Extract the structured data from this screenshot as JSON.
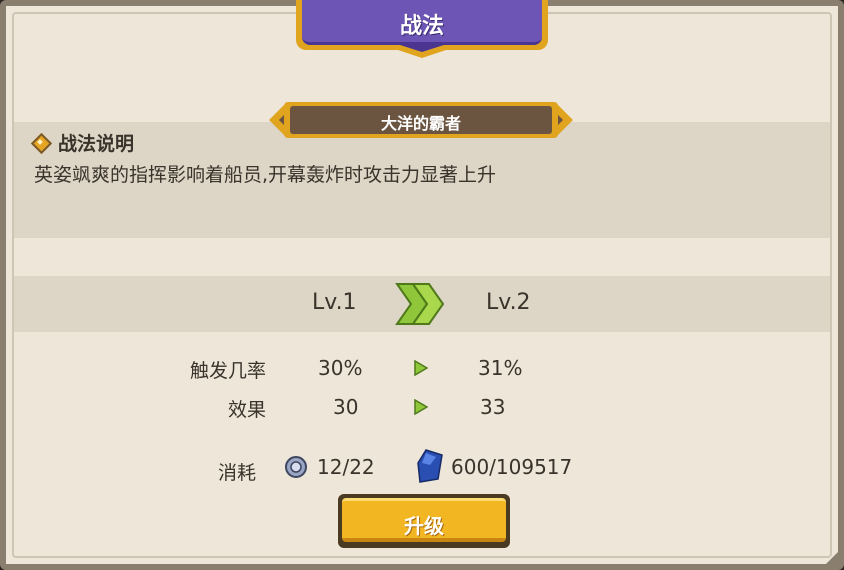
{
  "title": "战法",
  "skill_name": "大洋的霸者",
  "description": {
    "header": "战法说明",
    "text": "英姿飒爽的指挥影响着船员,开幕轰炸时攻击力显著上升"
  },
  "levels": {
    "current": "Lv.1",
    "next": "Lv.2"
  },
  "stats": [
    {
      "label": "触发几率",
      "current": "30%",
      "next": "31%"
    },
    {
      "label": "效果",
      "current": "30",
      "next": "33"
    }
  ],
  "cost": {
    "label": "消耗",
    "item_amount": "12/22",
    "gem_amount": "600/109517"
  },
  "upgrade_button": "升级",
  "colors": {
    "panel_bg": "#ede6d9",
    "title_purple": "#6d55b6",
    "gold": "#e0a41f",
    "button_yellow": "#f3b623",
    "arrow_green": "#8fc63a"
  },
  "icons": {
    "description": "diamond-icon",
    "level_arrow": "double-chevron-right-icon",
    "stat_arrow": "play-arrow-icon",
    "item_cost": "medal-icon",
    "gem_cost": "blue-gem-icon"
  }
}
